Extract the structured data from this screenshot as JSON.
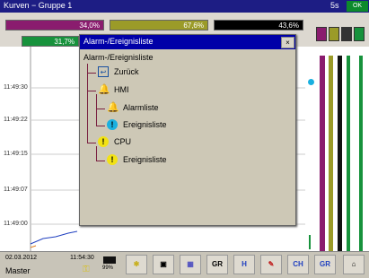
{
  "window": {
    "title": "Kurven − Gruppe 1",
    "time": "5s",
    "status_badge": "OK"
  },
  "bars": [
    {
      "value": "34,0%",
      "color": "#8a1c6e"
    },
    {
      "value": "67,6%",
      "color": "#9b9b28"
    },
    {
      "value": "43,6%",
      "color": "#000000"
    },
    {
      "value": "31,7%",
      "color": "#17923c"
    }
  ],
  "plot": {
    "time_ticks": [
      "11:49:30",
      "11:49:22",
      "11:49:15",
      "11:49:07",
      "11:49:00"
    ]
  },
  "dialog": {
    "title": "Alarm-/Ereignisliste",
    "close_label": "×",
    "header": "Alarm-/Ereignisliste",
    "items": [
      {
        "label": "Zurück",
        "icon": "back-icon"
      },
      {
        "label": "HMI",
        "icon": "bell-icon"
      },
      {
        "label": "Alarmliste",
        "icon": "bell-icon"
      },
      {
        "label": "Ereignisliste",
        "icon": "info-icon"
      },
      {
        "label": "CPU",
        "icon": "warning-icon"
      },
      {
        "label": "Ereignisliste",
        "icon": "warning-icon"
      }
    ]
  },
  "footer": {
    "date": "02.03.2012",
    "time": "11:54:30",
    "user": "Master",
    "battery": "99%",
    "buttons": [
      "bell",
      "camera",
      "calendar",
      "GR",
      "H",
      "pen",
      "CH",
      "GR",
      "home"
    ]
  },
  "colors": {
    "accent": "#0000a8",
    "titlebar": "#1d1d84",
    "dialog_bg": "#cdc8b6"
  }
}
